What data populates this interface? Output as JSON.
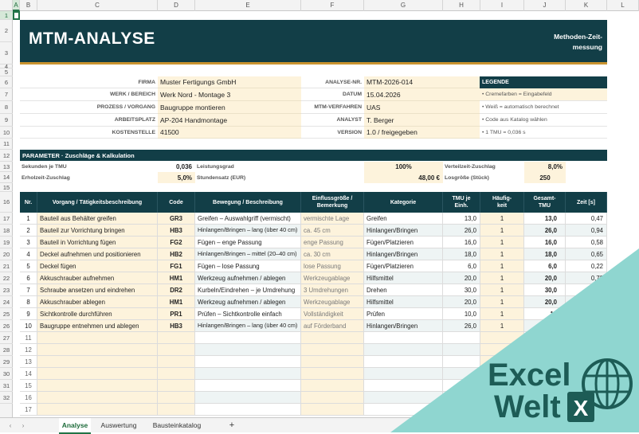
{
  "sheet": {
    "columns": [
      "A",
      "B",
      "C",
      "D",
      "E",
      "F",
      "G",
      "H",
      "I",
      "J",
      "K",
      "L"
    ],
    "rows": [
      "1",
      "2",
      "3",
      "4",
      "5",
      "6",
      "7",
      "8",
      "9",
      "10",
      "11",
      "12",
      "13",
      "14",
      "15",
      "16",
      "17",
      "18",
      "19",
      "20",
      "21",
      "22",
      "23",
      "24",
      "25",
      "26",
      "27",
      "28",
      "29",
      "30",
      "31",
      "32"
    ]
  },
  "header": {
    "title": "MTM-ANALYSE",
    "subtitle_line1": "Methoden-Zeit-",
    "subtitle_line2": "messung"
  },
  "info": {
    "firma_label": "FIRMA",
    "firma": "Muster Fertigungs GmbH",
    "werk_label": "WERK / BEREICH",
    "werk": "Werk Nord - Montage 3",
    "prozess_label": "PROZESS / VORGANG",
    "prozess": "Baugruppe montieren",
    "arbeitsplatz_label": "ARBEITSPLATZ",
    "arbeitsplatz": "AP-204 Handmontage",
    "kostenstelle_label": "KOSTENSTELLE",
    "kostenstelle": "41500",
    "analyse_nr_label": "ANALYSE-NR.",
    "analyse_nr": "MTM-2026-014",
    "datum_label": "DATUM",
    "datum": "15.04.2026",
    "verfahren_label": "MTM-VERFAHREN",
    "verfahren": "UAS",
    "analyst_label": "ANALYST",
    "analyst": "T. Berger",
    "version_label": "VERSION",
    "version": "1.0 / freigegeben"
  },
  "legend": {
    "title": "LEGENDE",
    "items": [
      "• Cremefarben = Eingabefeld",
      "• Weiß = automatisch berechnet",
      "• Code aus Katalog wählen",
      "• 1 TMU = 0,036 s"
    ]
  },
  "params": {
    "title": "PARAMETER  ·  Zuschläge & Kalkulation",
    "sek_label": "Sekunden je TMU",
    "sek": "0,036",
    "leist_label": "Leistungsgrad",
    "leist": "100%",
    "vert_label": "Verteilzeit-Zuschlag",
    "vert": "8,0%",
    "erhol_label": "Erholzeit-Zuschlag",
    "erhol": "5,0%",
    "stunden_label": "Stundensatz (EUR)",
    "stunden": "48,00 €",
    "los_label": "Losgröße (Stück)",
    "los": "250"
  },
  "table": {
    "headers": [
      "Nr.",
      "Vorgang / Tätigkeitsbeschreibung",
      "Code",
      "Bewegung / Beschreibung",
      "Einflussgröße / Bemerkung",
      "Kategorie",
      "TMU je Einh.",
      "Häufig-keit",
      "Gesamt-TMU",
      "Zeit [s]"
    ],
    "rows": [
      {
        "nr": "1",
        "vorgang": "Bauteil aus Behälter greifen",
        "code": "GR3",
        "bewegung": "Greifen – Auswahlgriff (vermischt)",
        "einfluss": "vermischte Lage",
        "kategorie": "Greifen",
        "tmu": "13,0",
        "haeuf": "1",
        "gesamt": "13,0",
        "zeit": "0,47"
      },
      {
        "nr": "2",
        "vorgang": "Bauteil zur Vorrichtung bringen",
        "code": "HB3",
        "bewegung": "Hinlangen/Bringen – lang (über 40 cm)",
        "einfluss": "ca. 45 cm",
        "kategorie": "Hinlangen/Bringen",
        "tmu": "26,0",
        "haeuf": "1",
        "gesamt": "26,0",
        "zeit": "0,94"
      },
      {
        "nr": "3",
        "vorgang": "Bauteil in Vorrichtung fügen",
        "code": "FG2",
        "bewegung": "Fügen – enge Passung",
        "einfluss": "enge Passung",
        "kategorie": "Fügen/Platzieren",
        "tmu": "16,0",
        "haeuf": "1",
        "gesamt": "16,0",
        "zeit": "0,58"
      },
      {
        "nr": "4",
        "vorgang": "Deckel aufnehmen und positionieren",
        "code": "HB2",
        "bewegung": "Hinlangen/Bringen – mittel (20–40 cm)",
        "einfluss": "ca. 30 cm",
        "kategorie": "Hinlangen/Bringen",
        "tmu": "18,0",
        "haeuf": "1",
        "gesamt": "18,0",
        "zeit": "0,65"
      },
      {
        "nr": "5",
        "vorgang": "Deckel fügen",
        "code": "FG1",
        "bewegung": "Fügen – lose Passung",
        "einfluss": "lose Passung",
        "kategorie": "Fügen/Platzieren",
        "tmu": "6,0",
        "haeuf": "1",
        "gesamt": "6,0",
        "zeit": "0,22"
      },
      {
        "nr": "6",
        "vorgang": "Akkuschrauber aufnehmen",
        "code": "HM1",
        "bewegung": "Werkzeug aufnehmen / ablegen",
        "einfluss": "Werkzeugablage",
        "kategorie": "Hilfsmittel",
        "tmu": "20,0",
        "haeuf": "1",
        "gesamt": "20,0",
        "zeit": "0,72"
      },
      {
        "nr": "7",
        "vorgang": "Schraube ansetzen und eindrehen",
        "code": "DR2",
        "bewegung": "Kurbeln/Eindrehen – je Umdrehung",
        "einfluss": "3 Umdrehungen",
        "kategorie": "Drehen",
        "tmu": "30,0",
        "haeuf": "1",
        "gesamt": "30,0",
        "zeit": ""
      },
      {
        "nr": "8",
        "vorgang": "Akkuschrauber ablegen",
        "code": "HM1",
        "bewegung": "Werkzeug aufnehmen / ablegen",
        "einfluss": "Werkzeugablage",
        "kategorie": "Hilfsmittel",
        "tmu": "20,0",
        "haeuf": "1",
        "gesamt": "20,0",
        "zeit": ""
      },
      {
        "nr": "9",
        "vorgang": "Sichtkontrolle durchführen",
        "code": "PR1",
        "bewegung": "Prüfen – Sichtkontrolle einfach",
        "einfluss": "Vollständigkeit",
        "kategorie": "Prüfen",
        "tmu": "10,0",
        "haeuf": "1",
        "gesamt": "10",
        "zeit": ""
      },
      {
        "nr": "10",
        "vorgang": "Baugruppe entnehmen und ablegen",
        "code": "HB3",
        "bewegung": "Hinlangen/Bringen – lang (über 40 cm)",
        "einfluss": "auf Förderband",
        "kategorie": "Hinlangen/Bringen",
        "tmu": "26,0",
        "haeuf": "1",
        "gesamt": "",
        "zeit": ""
      }
    ],
    "empty_nrs": [
      "11",
      "12",
      "13",
      "14",
      "15",
      "16",
      "17"
    ]
  },
  "tabs": {
    "active": "Analyse",
    "t2": "Auswertung",
    "t3": "Bausteinkatalog",
    "add": "+"
  },
  "logo": {
    "line1": "Excel",
    "line2": "Welt",
    "mark": "X"
  },
  "colors": {
    "banner": "#123e47",
    "accent": "#c9932f",
    "input": "#fdf3dc",
    "overlay": "#8fd6d0",
    "logo": "#1d5c56"
  }
}
